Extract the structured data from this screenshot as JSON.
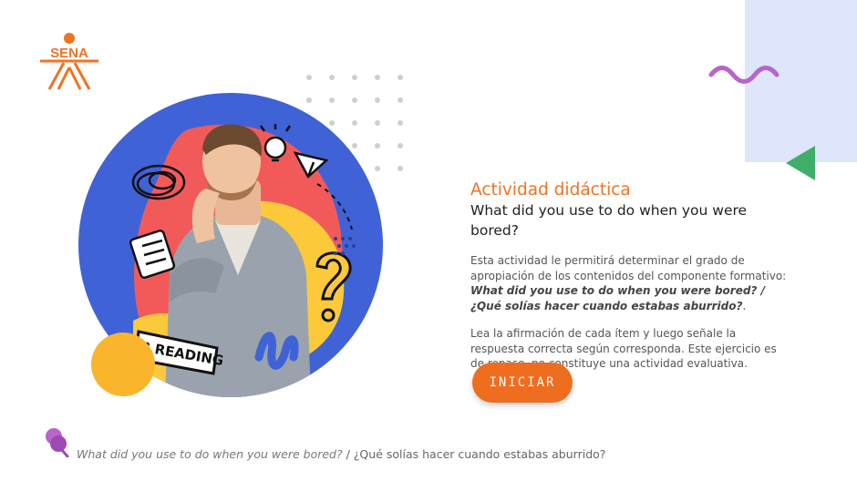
{
  "brand": {
    "logo_text": "SENA",
    "color": "#ee7322"
  },
  "hero": {
    "sticker_text": "I ♥ READING",
    "circle_color": "#3f63d6",
    "accent_yellow": "#fbb52c",
    "accent_red": "#f25a5a",
    "question_mark": "?"
  },
  "content": {
    "label": "Actividad didáctica",
    "title": "What did you use to do when you were bored?",
    "para1_intro": "Esta actividad le permitirá determinar el grado de apropiación de los contenidos del componente formativo: ",
    "para1_bold_en": "What did you use to do when you were bored? / ¿Qué solías hacer cuando estabas aburrido?",
    "para1_end": ".",
    "para2": "Lea la afirmación de cada ítem y luego señale la respuesta correcta según corresponda.  Este ejercicio es de repaso, no constituye una actividad evaluativa."
  },
  "start_button": {
    "label": "INICIAR",
    "color": "#ee6d1e"
  },
  "footer": {
    "text_en": "What did you use to do when you were bored?",
    "separator": " / ",
    "text_es": "¿Qué solías hacer cuando estabas aburrido?"
  },
  "decor": {
    "panel_color": "#dde6fb",
    "wave_color": "#b864c9",
    "triangle_color": "#3fae6a",
    "pin_icon": "pushpin-icon"
  }
}
